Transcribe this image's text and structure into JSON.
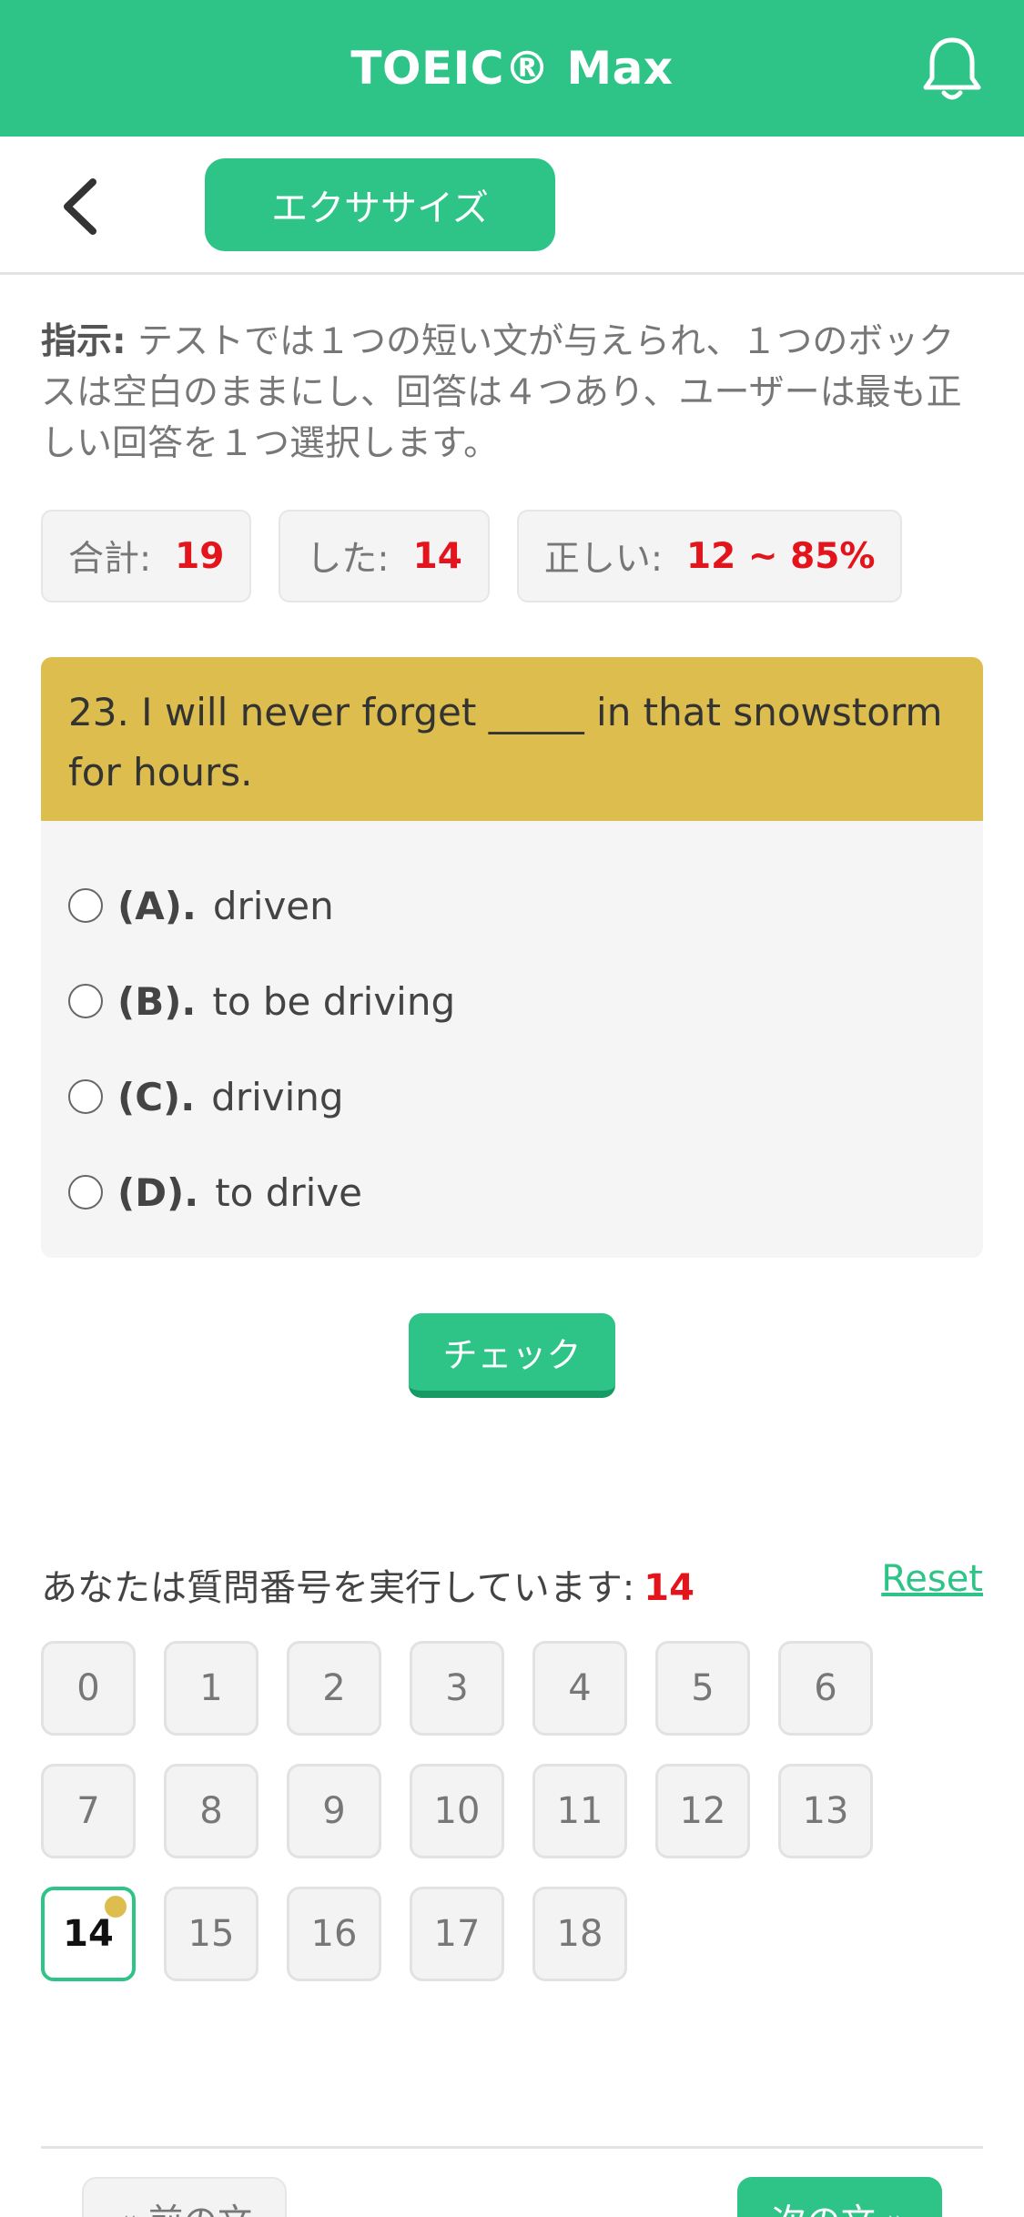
{
  "header": {
    "title": "TOEIC® Max",
    "bell_icon": "bell-icon"
  },
  "subheader": {
    "back_icon": "chevron-left-icon",
    "tab_label": "エクササイズ"
  },
  "instructions": {
    "label": "指示:",
    "text": " テストでは１つの短い文が与えられ、１つのボックスは空白のままにし、回答は４つあり、ユーザーは最も正しい回答を１つ選択します。"
  },
  "stats": {
    "total_label": "合計:",
    "total_value": "19",
    "done_label": "した:",
    "done_value": "14",
    "correct_label": "正しい:",
    "correct_value": "12 ~ 85%"
  },
  "question": {
    "text": "23. I will never forget _____ in that snowstorm for hours.",
    "options": [
      {
        "label": "(A).",
        "text": "driven"
      },
      {
        "label": "(B).",
        "text": "to be driving"
      },
      {
        "label": "(C).",
        "text": "driving"
      },
      {
        "label": "(D).",
        "text": "to drive"
      }
    ]
  },
  "check_button": "チェック",
  "progress": {
    "label": "あなたは質問番号を実行しています:",
    "current": "14",
    "reset": "Reset"
  },
  "numbers": [
    "0",
    "1",
    "2",
    "3",
    "4",
    "5",
    "6",
    "7",
    "8",
    "9",
    "10",
    "11",
    "12",
    "13",
    "14",
    "15",
    "16",
    "17",
    "18"
  ],
  "active_number": "14",
  "nav": {
    "prev": "« 前の文",
    "next": "次の文 »"
  },
  "colors": {
    "brand": "#2ec487",
    "question_bg": "#dcbd4d",
    "accent_red": "#e3141b"
  }
}
